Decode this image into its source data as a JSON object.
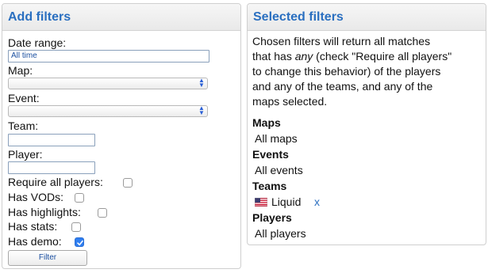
{
  "add_filters": {
    "title": "Add filters",
    "date_range": {
      "label": "Date range:",
      "value": "All time"
    },
    "map": {
      "label": "Map:",
      "value": ""
    },
    "event": {
      "label": "Event:",
      "value": ""
    },
    "team": {
      "label": "Team:",
      "value": ""
    },
    "player": {
      "label": "Player:",
      "value": ""
    },
    "checkboxes": [
      {
        "label": "Require all players:",
        "checked": false
      },
      {
        "label": "Has VODs:",
        "checked": false
      },
      {
        "label": "Has highlights:",
        "checked": false
      },
      {
        "label": "Has stats:",
        "checked": false
      },
      {
        "label": "Has demo:",
        "checked": true
      }
    ],
    "filter_button": "Filter"
  },
  "selected_filters": {
    "title": "Selected filters",
    "description": {
      "line1": "Chosen filters will return all matches",
      "line2_pre": "that has ",
      "line2_em": "any",
      "line2_post": " (check \"Require all players\"",
      "line3": "to change this behavior) of the players",
      "line4": "and any of the teams, and any of the",
      "line5": "maps selected."
    },
    "sections": {
      "maps": {
        "heading": "Maps",
        "value": "All maps"
      },
      "events": {
        "heading": "Events",
        "value": "All events"
      },
      "teams": {
        "heading": "Teams",
        "team_name": "Liquid",
        "flag": "us-flag-icon",
        "remove": "x"
      },
      "players": {
        "heading": "Players",
        "value": "All players"
      }
    }
  },
  "colors": {
    "header_text": "#2a6fc0",
    "checkbox_checked": "#2f7ef0"
  }
}
